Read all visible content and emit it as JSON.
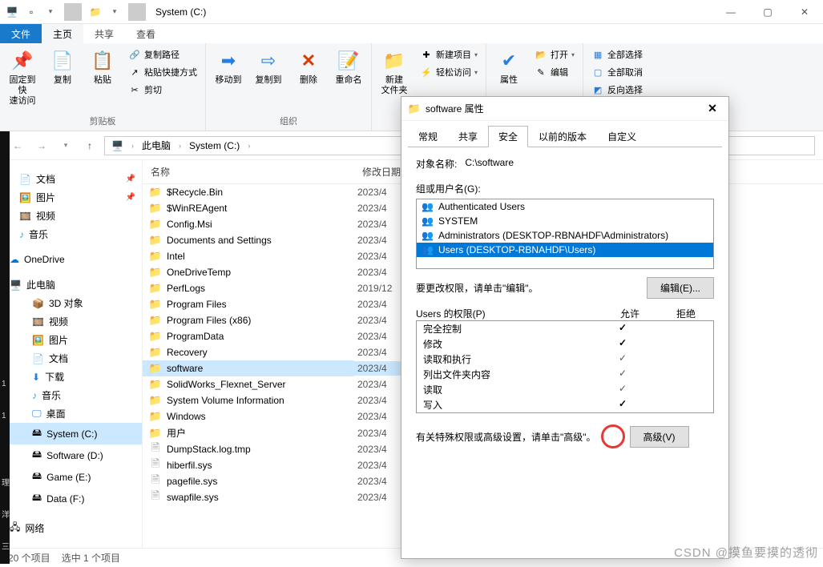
{
  "window": {
    "title": "System (C:)",
    "min": "—",
    "max": "▢",
    "close": "✕"
  },
  "tabs": {
    "file": "文件",
    "home": "主页",
    "share": "共享",
    "view": "查看"
  },
  "ribbon": {
    "clipboard_label": "剪贴板",
    "pin": "固定到快\n速访问",
    "copy": "复制",
    "paste": "粘贴",
    "copy_path": "复制路径",
    "paste_shortcut": "粘贴快捷方式",
    "cut": "剪切",
    "organize_label": "组织",
    "move_to": "移动到",
    "copy_to": "复制到",
    "delete": "删除",
    "rename": "重命名",
    "new_folder": "新建\n文件夹",
    "new_item": "新建项目",
    "easy_access": "轻松访问",
    "properties": "属性",
    "open": "打开",
    "edit": "编辑",
    "select_all": "全部选择",
    "select_none": "全部取消",
    "invert": "反向选择"
  },
  "breadcrumb": {
    "pc": "此电脑",
    "drive": "System (C:)"
  },
  "columns": {
    "name": "名称",
    "date": "修改日期"
  },
  "nav": {
    "documents": "文档",
    "pictures": "图片",
    "videos": "视频",
    "music": "音乐",
    "onedrive": "OneDrive",
    "thispc": "此电脑",
    "objects3d": "3D 对象",
    "videos2": "视频",
    "pictures2": "图片",
    "documents2": "文档",
    "downloads": "下载",
    "music2": "音乐",
    "desktop": "桌面",
    "c": "System (C:)",
    "d": "Software (D:)",
    "e": "Game (E:)",
    "f": "Data (F:)",
    "network": "网络"
  },
  "files": [
    {
      "name": "$Recycle.Bin",
      "date": "2023/4",
      "type": "folder"
    },
    {
      "name": "$WinREAgent",
      "date": "2023/4",
      "type": "folder"
    },
    {
      "name": "Config.Msi",
      "date": "2023/4",
      "type": "folder"
    },
    {
      "name": "Documents and Settings",
      "date": "2023/4",
      "type": "folder"
    },
    {
      "name": "Intel",
      "date": "2023/4",
      "type": "folder"
    },
    {
      "name": "OneDriveTemp",
      "date": "2023/4",
      "type": "folder"
    },
    {
      "name": "PerfLogs",
      "date": "2019/12",
      "type": "folder"
    },
    {
      "name": "Program Files",
      "date": "2023/4",
      "type": "folder"
    },
    {
      "name": "Program Files (x86)",
      "date": "2023/4",
      "type": "folder"
    },
    {
      "name": "ProgramData",
      "date": "2023/4",
      "type": "folder"
    },
    {
      "name": "Recovery",
      "date": "2023/4",
      "type": "folder"
    },
    {
      "name": "software",
      "date": "2023/4",
      "type": "folder",
      "selected": true
    },
    {
      "name": "SolidWorks_Flexnet_Server",
      "date": "2023/4",
      "type": "folder"
    },
    {
      "name": "System Volume Information",
      "date": "2023/4",
      "type": "folder"
    },
    {
      "name": "Windows",
      "date": "2023/4",
      "type": "folder"
    },
    {
      "name": "用户",
      "date": "2023/4",
      "type": "folder"
    },
    {
      "name": "DumpStack.log.tmp",
      "date": "2023/4",
      "type": "file"
    },
    {
      "name": "hiberfil.sys",
      "date": "2023/4",
      "type": "file"
    },
    {
      "name": "pagefile.sys",
      "date": "2023/4",
      "type": "file"
    },
    {
      "name": "swapfile.sys",
      "date": "2023/4",
      "type": "file"
    }
  ],
  "status": {
    "count": "20 个项目",
    "selection": "选中 1 个项目"
  },
  "dialog": {
    "title": "software 属性",
    "tabs": {
      "general": "常规",
      "share": "共享",
      "security": "安全",
      "prev": "以前的版本",
      "custom": "自定义"
    },
    "object_label": "对象名称:",
    "object_value": "C:\\software",
    "groups_label": "组或用户名(G):",
    "groups": [
      "Authenticated Users",
      "SYSTEM",
      "Administrators (DESKTOP-RBNAHDF\\Administrators)",
      "Users (DESKTOP-RBNAHDF\\Users)"
    ],
    "edit_hint": "要更改权限，请单击\"编辑\"。",
    "edit_btn": "编辑(E)...",
    "perm_label": "Users 的权限(P)",
    "allow": "允许",
    "deny": "拒绝",
    "perms": [
      {
        "name": "完全控制",
        "allow": true,
        "deny": false
      },
      {
        "name": "修改",
        "allow": true,
        "deny": false
      },
      {
        "name": "读取和执行",
        "allow": "g",
        "deny": false
      },
      {
        "name": "列出文件夹内容",
        "allow": "g",
        "deny": false
      },
      {
        "name": "读取",
        "allow": "g",
        "deny": false
      },
      {
        "name": "写入",
        "allow": true,
        "deny": false
      }
    ],
    "adv_hint": "有关特殊权限或高级设置，请单击\"高级\"。",
    "adv_btn": "高级(V)"
  },
  "watermark": "CSDN @摸鱼要摸的透彻"
}
